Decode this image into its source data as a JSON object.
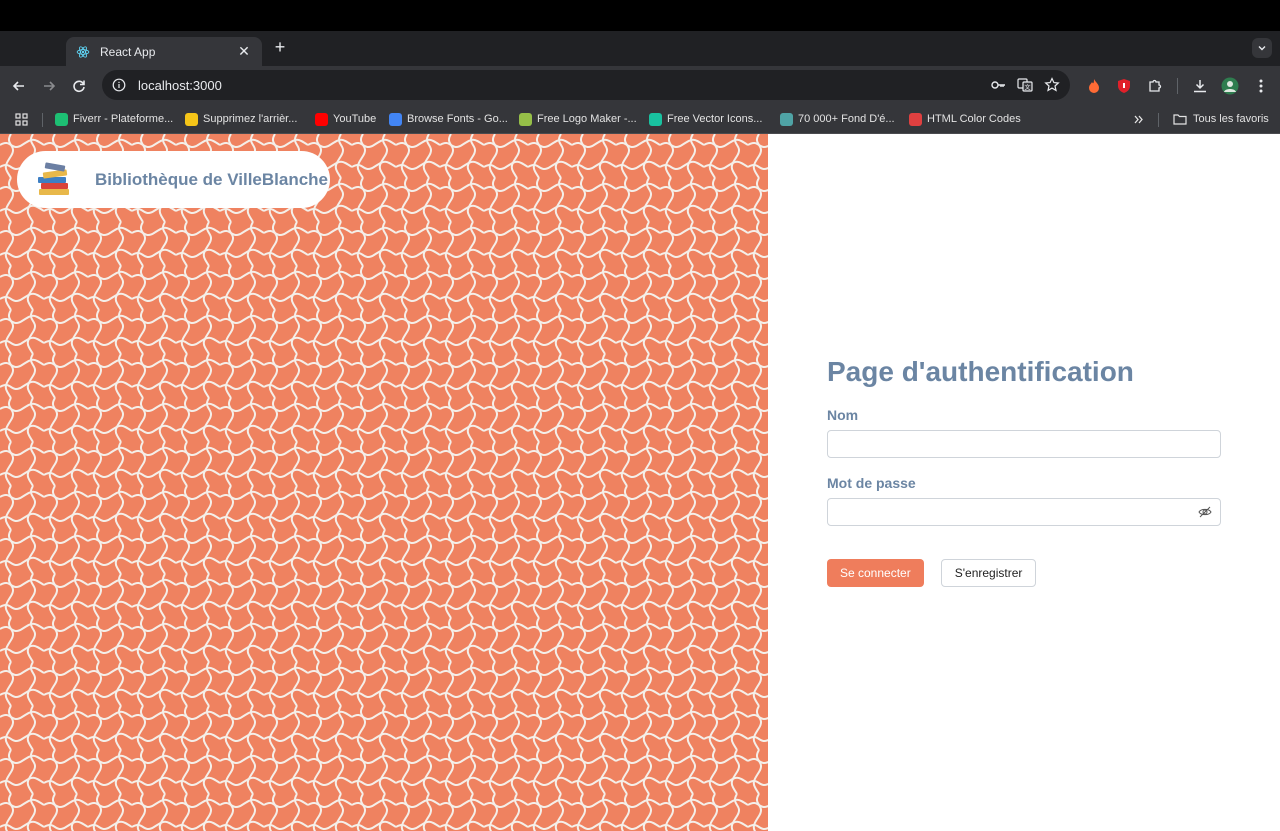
{
  "browser": {
    "tab": {
      "title": "React App",
      "favicon": "react-icon"
    },
    "address": {
      "url": "localhost:3000"
    },
    "bookmarks": [
      {
        "label": "Fiverr - Plateforme...",
        "color": "#1dbf73"
      },
      {
        "label": "Supprimez l'arrièr...",
        "color": "#f5c518"
      },
      {
        "label": "YouTube",
        "color": "#ff0000"
      },
      {
        "label": "Browse Fonts - Go...",
        "color": "#4285f4"
      },
      {
        "label": "Free Logo Maker -...",
        "color": "#96bf48"
      },
      {
        "label": "Free Vector Icons...",
        "color": "#19c2a0"
      },
      {
        "label": "70 000+ Fond D'é...",
        "color": "#4fa3a5"
      },
      {
        "label": "HTML Color Codes",
        "color": "#e04040"
      }
    ],
    "all_bookmarks": "Tous les favoris"
  },
  "app": {
    "brand_name": "Bibliothèque de VilleBlanche",
    "accent_color": "#ef8260",
    "heading_color": "#6b85a3"
  },
  "form": {
    "title": "Page d'authentification",
    "name_label": "Nom",
    "name_value": "",
    "password_label": "Mot de passe",
    "password_value": "",
    "login_button": "Se connecter",
    "register_button": "S'enregistrer"
  }
}
